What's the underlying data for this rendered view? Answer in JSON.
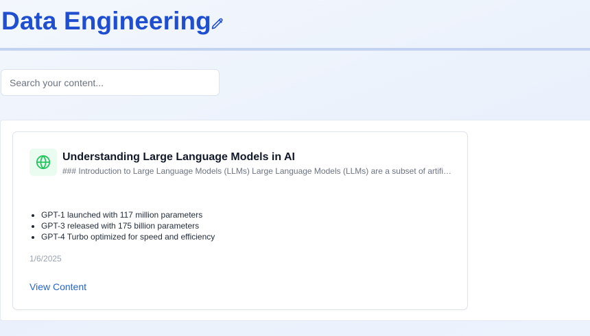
{
  "header": {
    "title": "Data Engineering",
    "edit_icon": "pencil-icon",
    "accent_color": "#1f4fcf"
  },
  "search": {
    "placeholder": "Search your content...",
    "value": ""
  },
  "content": {
    "cards": [
      {
        "icon": "globe-icon",
        "icon_color": "#22c55e",
        "title": "Understanding Large Language Models in AI",
        "excerpt": "### Introduction to Large Language Models (LLMs) Large Language Models (LLMs) are a subset of artifici...",
        "bullets": [
          "GPT-1 launched with 117 million parameters",
          "GPT-3 released with 175 billion parameters",
          "GPT-4 Turbo optimized for speed and efficiency"
        ],
        "date": "1/6/2025",
        "link_label": "View Content"
      }
    ]
  }
}
